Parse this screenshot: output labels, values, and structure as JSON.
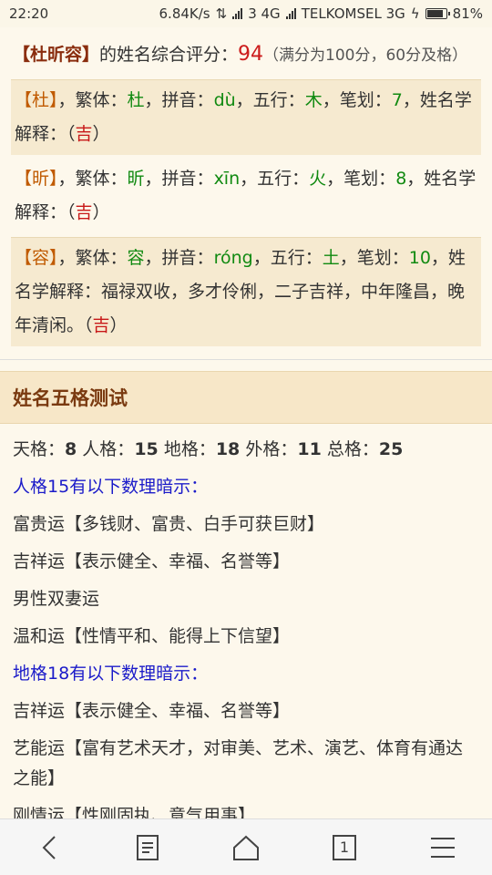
{
  "status": {
    "time": "22:20",
    "net_speed": "6.84K/s",
    "carrier1": "3 4G",
    "carrier2": "TELKOMSEL 3G",
    "battery": "81%"
  },
  "summary": {
    "name": "【杜昕容】",
    "text": "的姓名综合评分：",
    "score": "94",
    "note": "（满分为100分，60分及格）"
  },
  "chars": [
    {
      "ch": "【杜】",
      "trad_label": "，繁体：",
      "trad": "杜",
      "pinyin_label": "，拼音：",
      "pinyin": "dù",
      "wuxing_label": "，五行：",
      "wuxing": "木",
      "strokes_label": "，笔划：",
      "strokes": "7",
      "meaning_label": "，姓名学解释：（",
      "meaning": "",
      "luck": "吉",
      "close": "）"
    },
    {
      "ch": "【昕】",
      "trad_label": "，繁体：",
      "trad": "昕",
      "pinyin_label": "，拼音：",
      "pinyin": "xīn",
      "wuxing_label": "，五行：",
      "wuxing": "火",
      "strokes_label": "，笔划：",
      "strokes": "8",
      "meaning_label": "，姓名学解释：（",
      "meaning": "",
      "luck": "吉",
      "close": "）"
    },
    {
      "ch": "【容】",
      "trad_label": "，繁体：",
      "trad": "容",
      "pinyin_label": "，拼音：",
      "pinyin": "róng",
      "wuxing_label": "，五行：",
      "wuxing": "土",
      "strokes_label": "，笔划：",
      "strokes": "10",
      "meaning_label": "，姓名学解释：",
      "meaning": "福禄双收，多才伶俐，二子吉祥，中年隆昌，晚年清闲。",
      "luck": "吉",
      "open": "（",
      "close": "）"
    }
  ],
  "section": {
    "title": "姓名五格测试"
  },
  "wuge": {
    "tian_label": "天格：",
    "tian": "8",
    "ren_label": "人格：",
    "ren": "15",
    "di_label": "地格：",
    "di": "18",
    "wai_label": "外格：",
    "wai": "11",
    "zong_label": "总格：",
    "zong": "25"
  },
  "lines": [
    {
      "text": "人格15有以下数理暗示：",
      "style": "blue"
    },
    {
      "text": "富贵运【多钱财、富贵、白手可获巨财】",
      "style": "plain"
    },
    {
      "text": "吉祥运【表示健全、幸福、名誉等】",
      "style": "plain"
    },
    {
      "text": "男性双妻运",
      "style": "plain"
    },
    {
      "text": "温和运【性情平和、能得上下信望】",
      "style": "plain"
    },
    {
      "text": "地格18有以下数理暗示：",
      "style": "blue"
    },
    {
      "text": "吉祥运【表示健全、幸福、名誉等】",
      "style": "plain"
    },
    {
      "text": "艺能运【富有艺术天才，对审美、艺术、演艺、体育有通达之能】",
      "style": "wrap"
    },
    {
      "text": "刚情运【性刚固执、意气用事】",
      "style": "plain"
    }
  ],
  "nav": {
    "back": "back-icon",
    "menu": "document-icon",
    "home": "home-icon",
    "tabs": "1",
    "more": "menu-icon"
  }
}
